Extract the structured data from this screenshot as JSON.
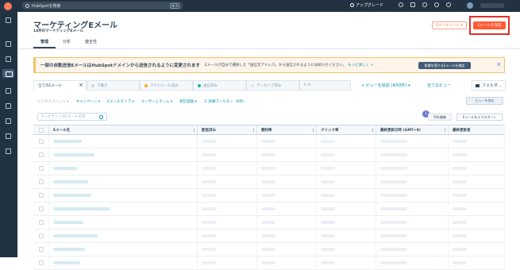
{
  "topbar": {
    "search_placeholder": "HubSpotを検索",
    "search_shortcut": "⌘ K",
    "upgrade_label": "アップグレード"
  },
  "header": {
    "title": "マーケティングEメール",
    "subtitle": "14件のマーケティングEメール",
    "tools_button": "Eメールツール ▾",
    "create_button": "Eメールを作成"
  },
  "page_tabs": [
    "管理",
    "分析",
    "健全性"
  ],
  "banner": {
    "bold_text": "一部の自動送信EメールはHubSpotドメインから送信されるように変更されます",
    "body_text": "Eメールが自分で選択した「送信元アドレス」から送信されるようにお知らせください。",
    "link_text": "もっと詳しく ↗",
    "button_label": "影響を受けるEメールを確認"
  },
  "view_tabs": [
    {
      "label": "全てのEメール",
      "active": true,
      "dot": ""
    },
    {
      "label": "下書き",
      "active": false,
      "dot": "#cbd6e2"
    },
    {
      "label": "スケジュール済み",
      "active": false,
      "dot": "#f5a623"
    },
    {
      "label": "送信済み",
      "active": false,
      "dot": "#00bda5"
    },
    {
      "label": "アーカイブ済み",
      "active": false,
      "dot": "#dfe3eb"
    },
    {
      "label": "E AI",
      "active": false,
      "dot": ""
    }
  ],
  "view_actions": {
    "add_view": "+ ビューを追加 (4/50件) ▾",
    "all_views": "全てのビュー",
    "folder": "フォルダ..."
  },
  "filters": {
    "business_unit": "ビジネスユニット ▾",
    "campaign": "キャンペーン ▾",
    "email_type": "Eメールタイプ ▾",
    "users_teams": "ユーザーとチーム ▾",
    "delivery": "配信登録 ▾",
    "advanced": "詳細フィルター（0件）",
    "save_view": "ビューを保存"
  },
  "table_controls": {
    "search_placeholder": "マーケティングEメールを检",
    "badge_count": "1",
    "edit_columns": "列を編集",
    "export": "Eメールをエクスポート"
  },
  "table": {
    "columns": [
      "Eメール名",
      "配信済み",
      "開封率",
      "クリック率",
      "最終更新日時 (GMT+9)",
      "最終更新者"
    ]
  },
  "colors": {
    "accent": "#ff5c35",
    "link": "#0091ae",
    "nav_bg": "#213343",
    "highlight_box": "#e0312a"
  }
}
